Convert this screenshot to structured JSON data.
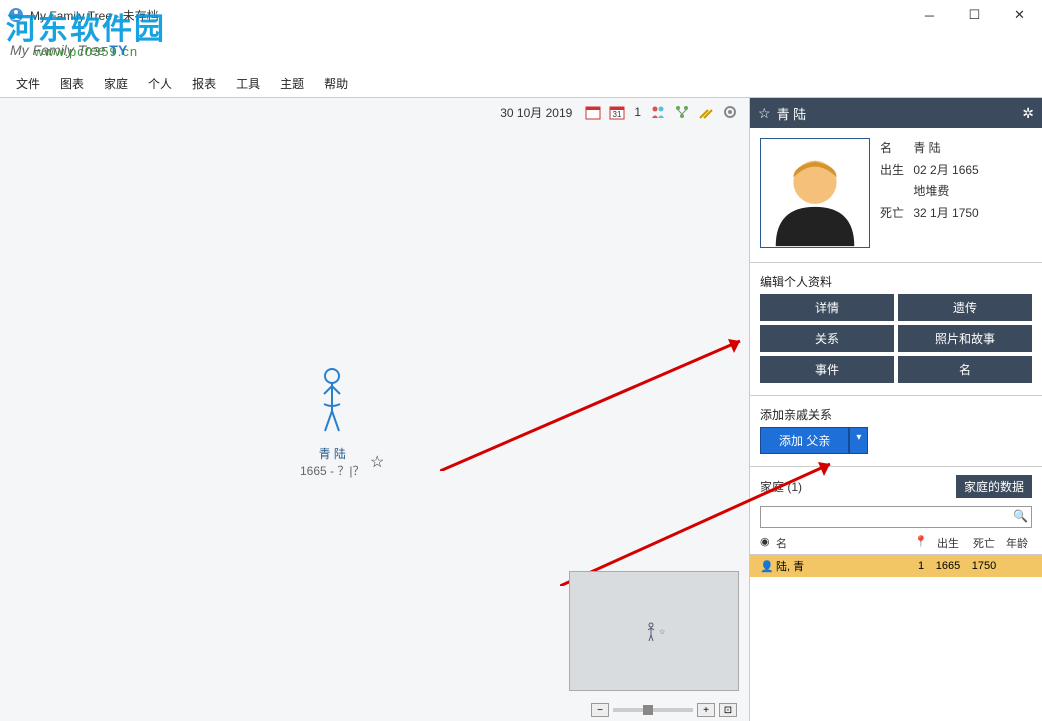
{
  "window": {
    "title": "My Family Tree - 未存档"
  },
  "watermark": {
    "cn": "河东软件园",
    "url": "www.pc0359.cn"
  },
  "brand": {
    "text": "My Family Tree",
    "badge": "TY"
  },
  "menu": {
    "file": "文件",
    "chart": "图表",
    "family": "家庭",
    "person": "个人",
    "report": "报表",
    "tool": "工具",
    "theme": "主题",
    "help": "帮助"
  },
  "toolbar": {
    "date": "30 10月 2019",
    "nav_count": "1"
  },
  "canvas": {
    "person_name": "青 陆",
    "person_life": "1665 - ？|？"
  },
  "panel": {
    "header_name": "青 陆",
    "profile": {
      "name_label": "名",
      "name_value": "青 陆",
      "birth_label": "出生",
      "birth_value": "02 2月 1665",
      "birth_place": "地堆费",
      "death_label": "死亡",
      "death_value": "32 1月 1750"
    },
    "edit_title": "编辑个人资料",
    "buttons": {
      "details": "详情",
      "heredity": "遗传",
      "relation": "关系",
      "photos": "照片和故事",
      "events": "事件",
      "name": "名"
    },
    "add_title": "添加亲戚关系",
    "add_father": "添加 父亲",
    "family_label": "家庭 (1)",
    "family_data": "家庭的数据",
    "table_headers": {
      "name": "名",
      "birth": "出生",
      "death": "死亡",
      "age": "年龄"
    },
    "row": {
      "name": "陆, 青",
      "num": "1",
      "birth": "1665",
      "death": "1750",
      "age": ""
    }
  }
}
